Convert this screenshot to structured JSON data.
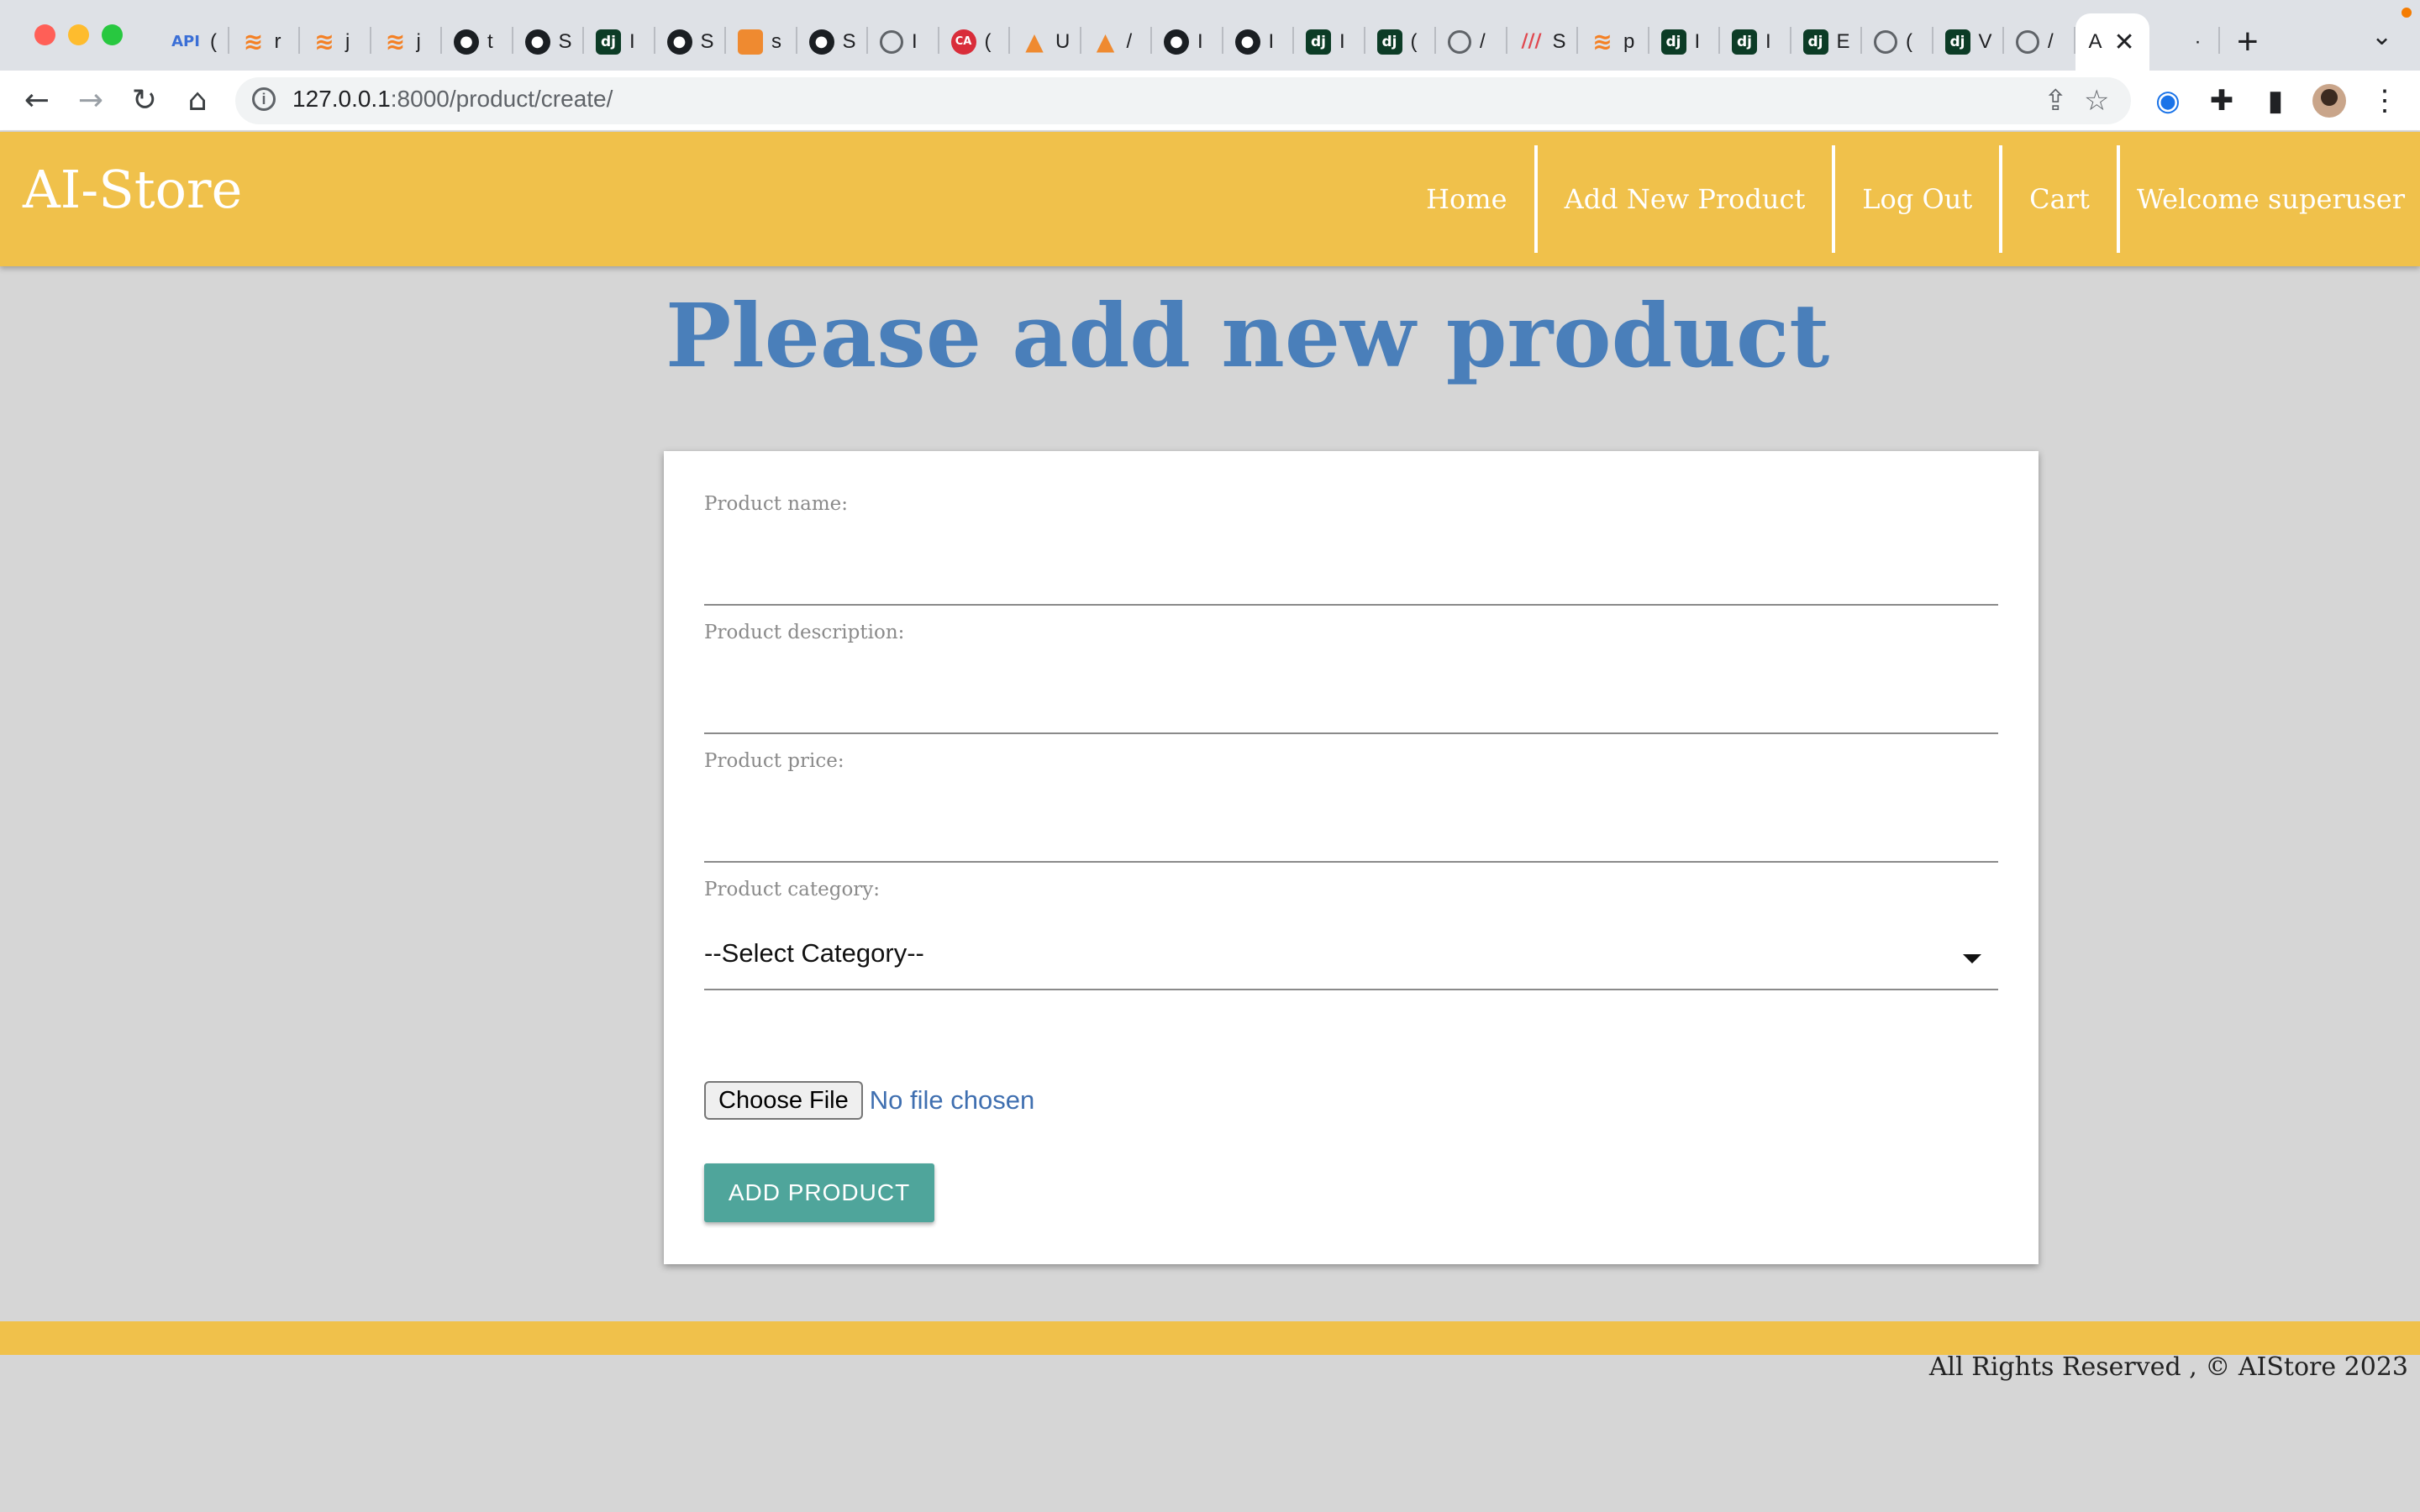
{
  "browser": {
    "tabs": [
      {
        "icon": "api-icon",
        "glyph": "API",
        "label": "(",
        "style": "api"
      },
      {
        "icon": "stackoverflow-icon",
        "glyph": "≋",
        "label": "r",
        "style": "so"
      },
      {
        "icon": "stackoverflow-icon",
        "glyph": "≋",
        "label": "j",
        "style": "so"
      },
      {
        "icon": "stackoverflow-icon",
        "glyph": "≋",
        "label": "j",
        "style": "so"
      },
      {
        "icon": "github-icon",
        "glyph": "●",
        "label": "t",
        "style": "gh"
      },
      {
        "icon": "github-icon",
        "glyph": "●",
        "label": "S",
        "style": "gh"
      },
      {
        "icon": "django-icon",
        "glyph": "dj",
        "label": "I",
        "style": "dj"
      },
      {
        "icon": "github-icon",
        "glyph": "●",
        "label": "S",
        "style": "gh"
      },
      {
        "icon": "package-icon",
        "glyph": "",
        "label": "s",
        "style": "box"
      },
      {
        "icon": "github-icon",
        "glyph": "●",
        "label": "S",
        "style": "gh"
      },
      {
        "icon": "globe-icon",
        "glyph": "",
        "label": "I",
        "style": "globe"
      },
      {
        "icon": "ca-icon",
        "glyph": "CA",
        "label": "(",
        "style": "ca"
      },
      {
        "icon": "stack-icon",
        "glyph": "▲",
        "label": "U",
        "style": "tri"
      },
      {
        "icon": "stack-icon",
        "glyph": "▲",
        "label": "/",
        "style": "tri"
      },
      {
        "icon": "github-icon",
        "glyph": "●",
        "label": "I",
        "style": "gh"
      },
      {
        "icon": "github-icon",
        "glyph": "●",
        "label": "I",
        "style": "gh"
      },
      {
        "icon": "django-icon",
        "glyph": "dj",
        "label": "I",
        "style": "dj"
      },
      {
        "icon": "django-icon",
        "glyph": "dj",
        "label": "(",
        "style": "dj"
      },
      {
        "icon": "globe-icon",
        "glyph": "",
        "label": "/",
        "style": "globe"
      },
      {
        "icon": "miro-icon",
        "glyph": "///",
        "label": "S",
        "style": "mi"
      },
      {
        "icon": "stackoverflow-icon",
        "glyph": "≋",
        "label": "p",
        "style": "so"
      },
      {
        "icon": "django-icon",
        "glyph": "dj",
        "label": "I",
        "style": "dj"
      },
      {
        "icon": "django-icon",
        "glyph": "dj",
        "label": "I",
        "style": "dj"
      },
      {
        "icon": "django-icon",
        "glyph": "dj",
        "label": "E",
        "style": "dj"
      },
      {
        "icon": "globe-icon",
        "glyph": "",
        "label": "(",
        "style": "globe"
      },
      {
        "icon": "django-icon",
        "glyph": "dj",
        "label": "V",
        "style": "dj"
      },
      {
        "icon": "globe-icon",
        "glyph": "",
        "label": "/",
        "style": "globe"
      }
    ],
    "active_tab": {
      "label": "A",
      "close": "✕"
    },
    "last_tab": {
      "icon": "apple-icon",
      "glyph": "",
      "label": "·"
    },
    "new_tab": "+",
    "tab_menu": "⌄",
    "url_host": "127.0.0.1",
    "url_rest": ":8000/product/create/"
  },
  "site": {
    "logo": "AI-Store",
    "nav": {
      "home": "Home",
      "add_product": "Add New Product",
      "logout": "Log Out",
      "cart": "Cart",
      "welcome": "Welcome superuser"
    },
    "title": "Please add new product"
  },
  "form": {
    "name_label": "Product name:",
    "name_value": "",
    "description_label": "Product description:",
    "description_value": "",
    "price_label": "Product price:",
    "price_value": "",
    "category_label": "Product category:",
    "category_selected": "--Select Category--",
    "file_button": "Choose File",
    "file_status": "No file chosen",
    "submit": "ADD PRODUCT"
  },
  "footer": {
    "text": "All Rights Reserved , © AIStore 2023"
  },
  "colors": {
    "header": "#f0c14b",
    "title": "#4a7fba",
    "button": "#4fa59b",
    "background": "#d6d6d6"
  }
}
